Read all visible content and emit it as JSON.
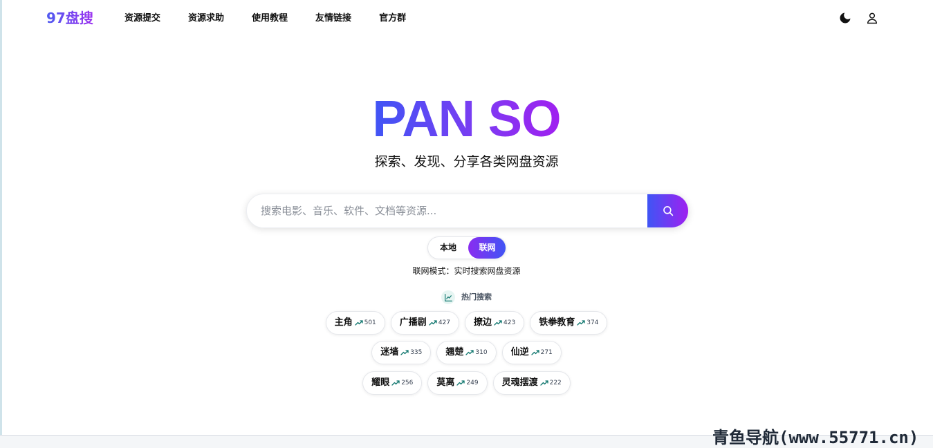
{
  "header": {
    "logo": "97盘搜",
    "nav": [
      "资源提交",
      "资源求助",
      "使用教程",
      "友情链接",
      "官方群"
    ],
    "theme_icon": "moon-icon",
    "user_icon": "user-icon"
  },
  "hero": {
    "title": "PAN SO",
    "subtitle": "探索、发现、分享各类网盘资源"
  },
  "search": {
    "placeholder": "搜索电影、音乐、软件、文档等资源...",
    "value": "",
    "button_icon": "search-icon"
  },
  "mode": {
    "local_label": "本地",
    "online_label": "联网",
    "selected": "联网",
    "description": "联网模式：实时搜索网盘资源"
  },
  "hot": {
    "label": "热门搜索",
    "icon": "trend-chart-icon",
    "rows": [
      [
        {
          "name": "主角",
          "count": "501"
        },
        {
          "name": "广播剧",
          "count": "427"
        },
        {
          "name": "撩边",
          "count": "423"
        },
        {
          "name": "铁拳教育",
          "count": "374"
        }
      ],
      [
        {
          "name": "迷墙",
          "count": "335"
        },
        {
          "name": "翘楚",
          "count": "310"
        },
        {
          "name": "仙逆",
          "count": "271"
        }
      ],
      [
        {
          "name": "耀眼",
          "count": "256"
        },
        {
          "name": "莫离",
          "count": "249"
        },
        {
          "name": "灵魂摆渡",
          "count": "222"
        }
      ]
    ]
  },
  "colors": {
    "brand_start": "#3f55f5",
    "brand_end": "#a020f0",
    "trend": "#0f766e"
  },
  "watermark": "青鱼导航(www.55771.cn)"
}
